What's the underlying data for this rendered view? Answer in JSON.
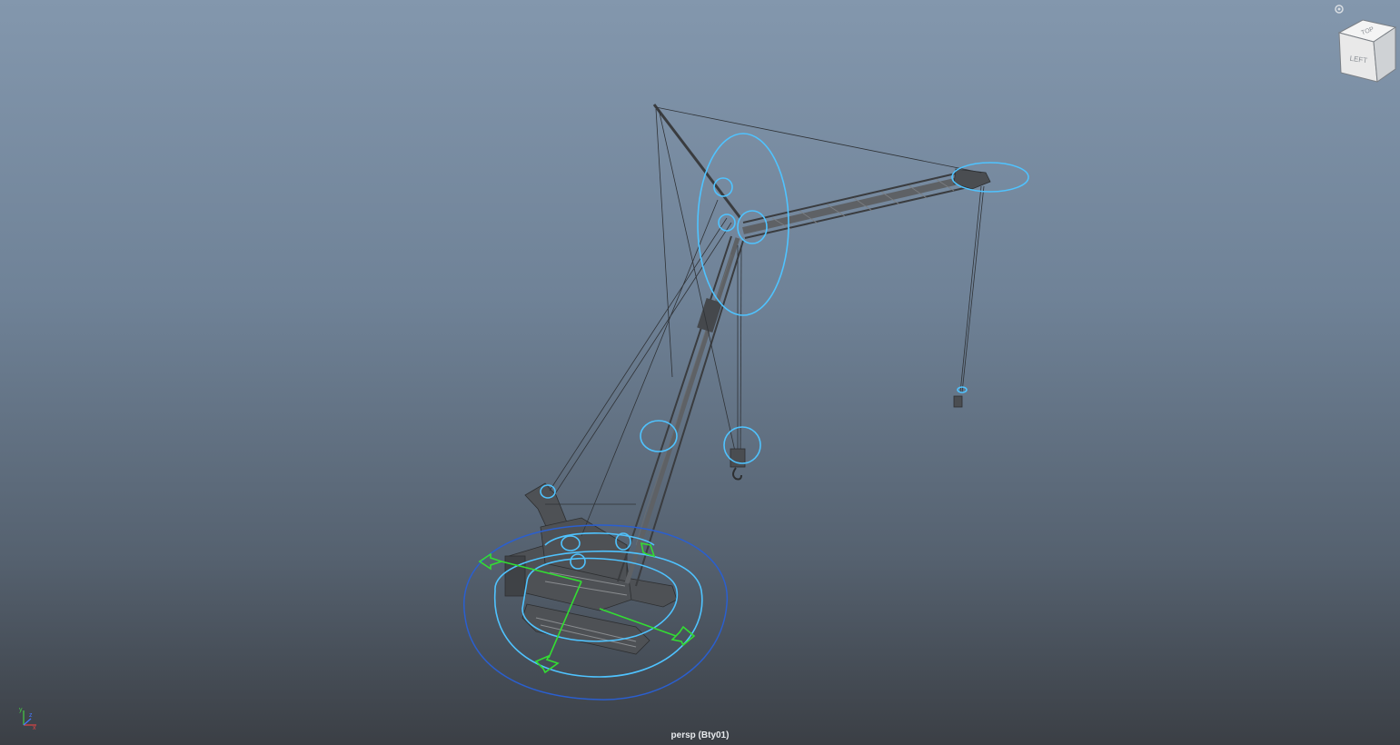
{
  "viewport": {
    "camera_label": "persp (Bty01)",
    "background_top": "#8397ad",
    "background_bottom": "#3b3f45"
  },
  "viewcube": {
    "top_face": "TOP",
    "front_face": "LEFT",
    "home_icon": "home-icon"
  },
  "axis": {
    "y": "y",
    "x": "x",
    "z": "z"
  },
  "colors": {
    "controller_cyan": "#4fc3ff",
    "controller_blue": "#2a5fd0",
    "move_handle_green": "#33dd33",
    "mesh_gray": "#55585c"
  }
}
